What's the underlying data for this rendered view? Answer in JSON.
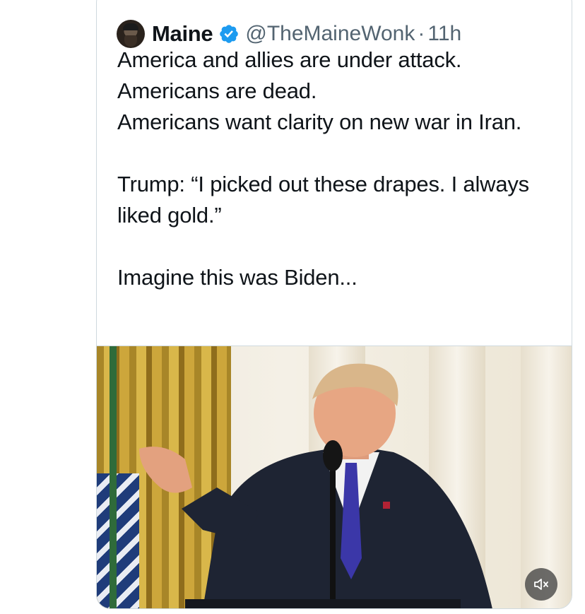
{
  "tweet": {
    "author_name": "Maine",
    "handle": "@TheMaineWonk",
    "separator": "·",
    "timestamp": "11h",
    "lines": [
      "America and allies are under attack.",
      "Americans are dead.",
      "Americans want clarity on new war in Iran."
    ],
    "quote": "Trump: “I picked out these drapes. I always liked gold.”",
    "closing": "Imagine this was Biden..."
  },
  "icons": {
    "verified": "verified-badge-icon",
    "mute": "volume-muted-icon"
  },
  "colors": {
    "verified": "#1d9bf0",
    "secondary_text": "#536471",
    "border": "#cfd9de"
  }
}
